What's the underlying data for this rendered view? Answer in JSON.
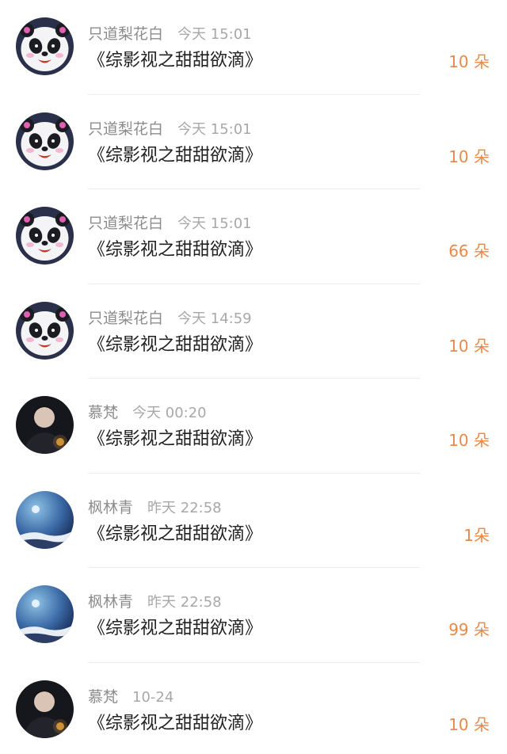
{
  "items": [
    {
      "user": "只道梨花白",
      "time": "今天 15:01",
      "book": "《综影视之甜甜欲滴》",
      "amount": "10 朵",
      "avatar": "panda-avatar"
    },
    {
      "user": "只道梨花白",
      "time": "今天 15:01",
      "book": "《综影视之甜甜欲滴》",
      "amount": "10 朵",
      "avatar": "panda-avatar"
    },
    {
      "user": "只道梨花白",
      "time": "今天 15:01",
      "book": "《综影视之甜甜欲滴》",
      "amount": "66 朵",
      "avatar": "panda-avatar"
    },
    {
      "user": "只道梨花白",
      "time": "今天 14:59",
      "book": "《综影视之甜甜欲滴》",
      "amount": "10 朵",
      "avatar": "panda-avatar"
    },
    {
      "user": "慕梵",
      "time": "今天 00:20",
      "book": "《综影视之甜甜欲滴》",
      "amount": "10 朵",
      "avatar": "portrait-avatar"
    },
    {
      "user": "枫林青",
      "time": "昨天 22:58",
      "book": "《综影视之甜甜欲滴》",
      "amount": "1朵",
      "avatar": "moon-avatar"
    },
    {
      "user": "枫林青",
      "time": "昨天 22:58",
      "book": "《综影视之甜甜欲滴》",
      "amount": "99 朵",
      "avatar": "moon-avatar"
    },
    {
      "user": "慕梵",
      "time": "10-24",
      "book": "《综影视之甜甜欲滴》",
      "amount": "10 朵",
      "avatar": "portrait-avatar"
    }
  ],
  "colors": {
    "amount": "#e8894a",
    "username": "#8c8c8c",
    "time": "#a8a8a8",
    "title": "#222222",
    "divider": "#ececec"
  }
}
